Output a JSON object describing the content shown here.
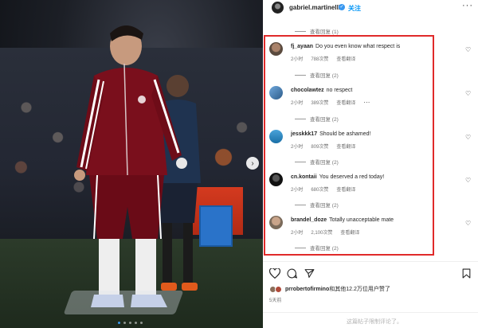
{
  "header": {
    "username": "gabriel.martinelli",
    "follow_label": "关注",
    "more_label": "···"
  },
  "replies": [
    {
      "label": "查看回复 (1)"
    },
    {
      "label": "查看回复 (2)"
    },
    {
      "label": "查看回复 (2)"
    },
    {
      "label": "查看回复 (2)"
    },
    {
      "label": "查看回复 (2)"
    },
    {
      "label": "查看回复 (2)"
    }
  ],
  "comments": [
    {
      "username": "fj_ayaan",
      "text": "Do you even know what respect is",
      "time": "2小时",
      "likes": "788次赞",
      "translate": "查看翻译",
      "more": ""
    },
    {
      "username": "chocolawtez",
      "text": "no respect",
      "time": "2小时",
      "likes": "389次赞",
      "translate": "查看翻译",
      "more": "···"
    },
    {
      "username": "jesskkk17",
      "text": "Should be ashamed!",
      "time": "2小时",
      "likes": "809次赞",
      "translate": "查看翻译",
      "more": ""
    },
    {
      "username": "cn.kontaii",
      "text": "You deserved a red today!",
      "time": "2小时",
      "likes": "680次赞",
      "translate": "查看翻译",
      "more": ""
    },
    {
      "username": "brandel_doze",
      "text": "Totally unacceptable mate",
      "time": "2小时",
      "likes": "2,100次赞",
      "translate": "查看翻译",
      "more": ""
    }
  ],
  "liked_by": {
    "user": "prrobertofirmino",
    "text": "和其他12.2万位用户赞了"
  },
  "posted": "5天前",
  "footer_note": "这篇帖子限制评论了。",
  "colors": {
    "highlight": "#e02a2a",
    "link": "#0095f6",
    "verified": "#3897f0"
  },
  "icons": [
    "heart-icon",
    "comment-icon",
    "share-icon",
    "bookmark-icon",
    "verified-icon",
    "next-arrow-icon"
  ]
}
